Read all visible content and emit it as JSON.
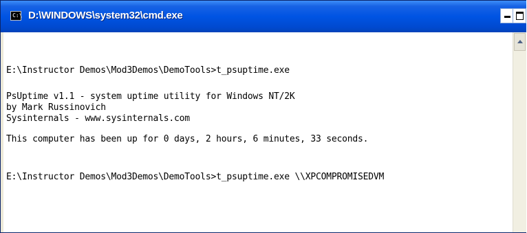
{
  "window": {
    "title": "D:\\WINDOWS\\system32\\cmd.exe",
    "icon": "cmd-icon",
    "title_bar_color": "#0054e3"
  },
  "controls": {
    "minimize_icon": "minimize-icon",
    "maximize_icon": "maximize-icon"
  },
  "console": {
    "background": "#ffffff",
    "text_color": "#000000",
    "lines": [
      "E:\\Instructor Demos\\Mod3Demos\\DemoTools>t_psuptime.exe",
      "PsUptime v1.1 - system uptime utility for Windows NT/2K",
      "by Mark Russinovich",
      "Sysinternals - www.sysinternals.com",
      "This computer has been up for 0 days, 2 hours, 6 minutes, 33 seconds.",
      "E:\\Instructor Demos\\Mod3Demos\\DemoTools>t_psuptime.exe \\\\XPCOMPROMISEDVM"
    ]
  },
  "scrollbar": {
    "up_icon": "scroll-up-arrow-icon"
  }
}
